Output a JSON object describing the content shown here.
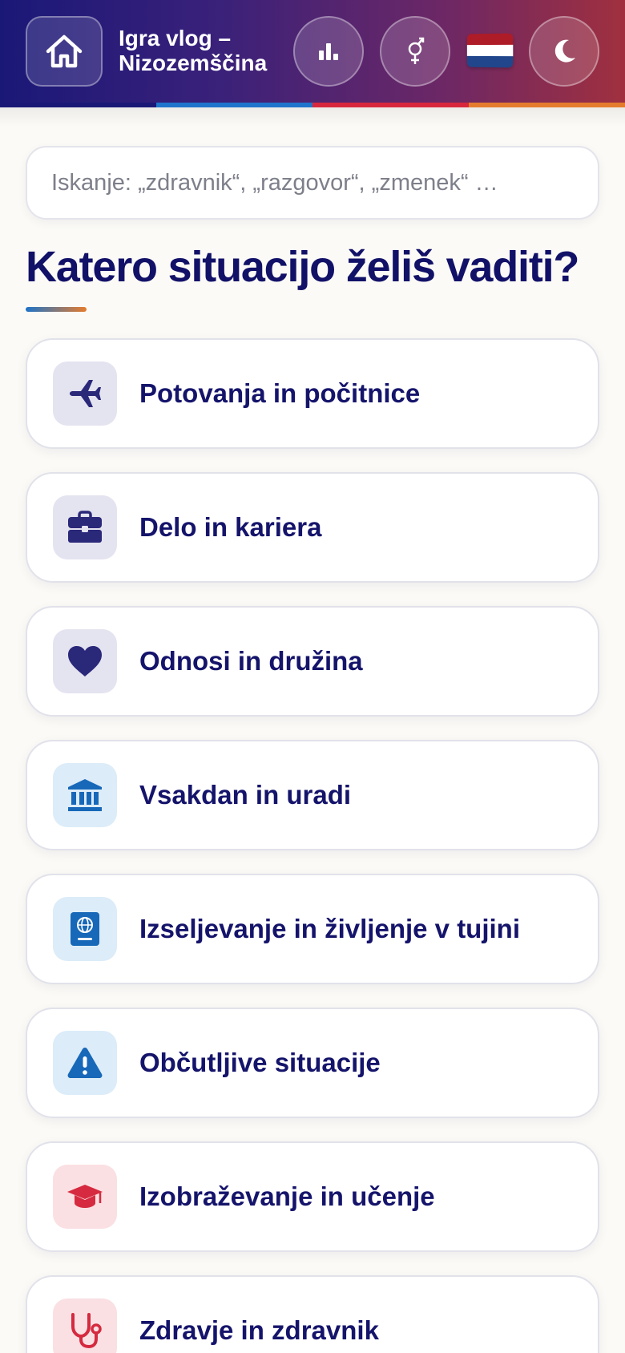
{
  "header": {
    "title": "Igra vlog – Nizozemščina",
    "stripe_colors": [
      "#1a1877",
      "#1f74cc",
      "#d8273d",
      "#e57c2d"
    ]
  },
  "search": {
    "placeholder": "Iskanje: „zdravnik“, „razgovor“, „zmenek“ …"
  },
  "main": {
    "title": "Katero situacijo želiš vaditi?"
  },
  "categories": [
    {
      "label": "Potovanja in počitnice",
      "icon": "airplane-icon",
      "tone": "purple",
      "color": "#2a2879"
    },
    {
      "label": "Delo in kariera",
      "icon": "briefcase-icon",
      "tone": "purple",
      "color": "#2a2879"
    },
    {
      "label": "Odnosi in družina",
      "icon": "heart-icon",
      "tone": "purple",
      "color": "#2a2879"
    },
    {
      "label": "Vsakdan in uradi",
      "icon": "bank-icon",
      "tone": "blue",
      "color": "#1768b8"
    },
    {
      "label": "Izseljevanje in življenje v tujini",
      "icon": "passport-icon",
      "tone": "blue",
      "color": "#1768b8"
    },
    {
      "label": "Občutljive situacije",
      "icon": "warning-icon",
      "tone": "blue",
      "color": "#1768b8"
    },
    {
      "label": "Izobraževanje in učenje",
      "icon": "graduation-cap-icon",
      "tone": "red",
      "color": "#d52a3f"
    },
    {
      "label": "Zdravje in zdravnik",
      "icon": "stethoscope-icon",
      "tone": "red",
      "color": "#d52a3f"
    }
  ],
  "flag_colors": [
    "#ae1c28",
    "#ffffff",
    "#21468b"
  ]
}
